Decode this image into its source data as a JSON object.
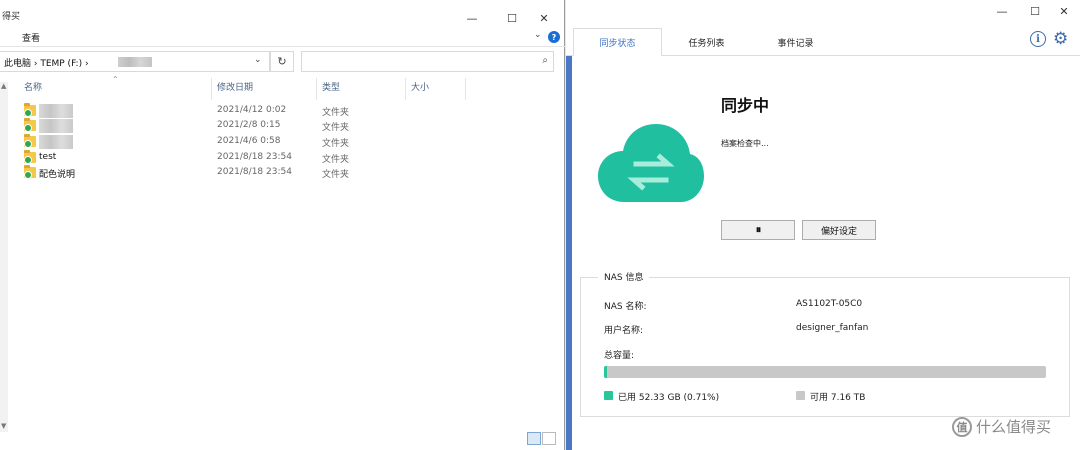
{
  "explorer": {
    "title": "得买",
    "ribbon_tab": "查看",
    "address": "此电脑 › TEMP (F:) ›",
    "search_placeholder": "",
    "columns": {
      "name": "名称",
      "date": "修改日期",
      "type": "类型",
      "size": "大小"
    },
    "rows": [
      {
        "name": "",
        "date": "2021/4/12 0:02",
        "type": "文件夹",
        "blurred": true
      },
      {
        "name": "",
        "date": "2021/2/8 0:15",
        "type": "文件夹",
        "blurred": true
      },
      {
        "name": "",
        "date": "2021/4/6 0:58",
        "type": "文件夹",
        "blurred": true
      },
      {
        "name": "test",
        "date": "2021/8/18 23:54",
        "type": "文件夹",
        "blurred": false
      },
      {
        "name": "配色说明",
        "date": "2021/8/18 23:54",
        "type": "文件夹",
        "blurred": false
      }
    ]
  },
  "app": {
    "tabs": [
      "同步状态",
      "任务列表",
      "事件记录"
    ],
    "active_tab": 0,
    "status_title": "同步中",
    "status_sub": "档案检查中...",
    "pause_label": "⏸",
    "prefs_label": "偏好设定",
    "nas": {
      "legend": "NAS 信息",
      "name_label": "NAS 名称:",
      "name_value": "AS1102T-05C0",
      "user_label": "用户名称:",
      "user_value": "designer_fanfan",
      "capacity_label": "总容量:",
      "used_fraction": 0.0071,
      "used_label": "已用 52.33 GB (0.71%)",
      "free_label": "可用 7.16 TB",
      "used_color": "#2ac69a",
      "free_color": "#c8c8c8"
    }
  },
  "watermark": "什么值得买",
  "colors": {
    "accent": "#3e73c8",
    "cloud": "#1fbfa0"
  }
}
